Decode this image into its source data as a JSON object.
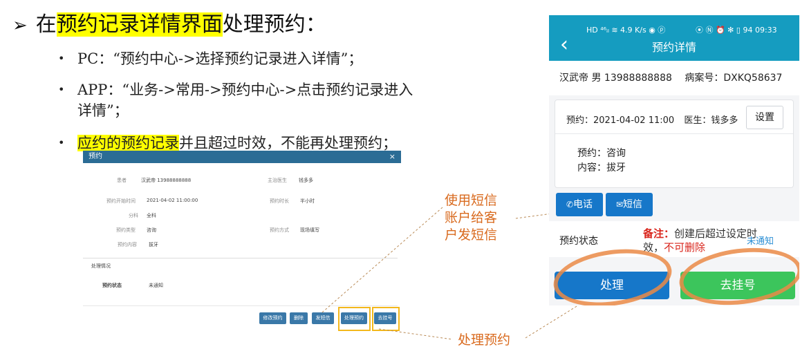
{
  "slide": {
    "main_arrow": "➢",
    "main_prefix": "在",
    "main_highlight": "预约记录详情界面",
    "main_suffix": "处理预约：",
    "bullets": [
      {
        "text": "PC：“预约中心->选择预约记录进入详情”；"
      },
      {
        "line1": "APP：“业务->常用->预约中心->点击预约记录进入",
        "line2": "详情”；"
      },
      {
        "highlight": "应约的预约记录",
        "rest": "并且超过时效，不能再处理预约；"
      }
    ],
    "callout_sms": [
      "使用短信",
      "账户给客",
      "户发短信"
    ],
    "callout_process": "处理预约"
  },
  "pc": {
    "title": "预约",
    "close": "×",
    "fields": {
      "patient_label": "患者",
      "patient_value": "汉武帝 13988888888",
      "doctor_label": "主治医生",
      "doctor_value": "钱多多",
      "start_label": "预约开始时间",
      "start_value": "2021-04-02 11:00:00",
      "duration_label": "预约时长",
      "duration_value": "半小时",
      "dept_label": "分科",
      "dept_value": "全科",
      "type_label": "预约类型",
      "type_value": "咨询",
      "method_label": "预约方式",
      "method_value": "现场填写",
      "content_label": "预约内容",
      "content_value": "拔牙"
    },
    "section_title": "处理情况",
    "status_label": "预约状态",
    "status_value": "未通知",
    "buttons": [
      "修改预约",
      "删除",
      "发短信",
      "处理预约",
      "去挂号"
    ]
  },
  "app": {
    "status_left": "HD ⁴⁶ᵢₗ ≋ 4.9 K/s ◉ ⓟ",
    "status_right": "⦿ Ⓝ ⏰ ✻ ▯ 94 09:33",
    "back_icon": "‹",
    "title": "预约详情",
    "patient_name": "汉武帝",
    "patient_gender": "男",
    "patient_phone": "13988888888",
    "record_label": "病案号：",
    "record_value": "DXKQ58637",
    "appt_time_label": "预约：",
    "appt_time_value": "2021-04-02 11:00",
    "doctor_label": "医生：",
    "doctor_value": "钱多多",
    "settings_button": "设置",
    "appt_type_label": "预约：",
    "appt_type_value": "咨询",
    "content_label": "内容：",
    "content_value": "拔牙",
    "call_button": "电话",
    "sms_button": "短信",
    "status_label": "预约状态",
    "status_value": "未通知",
    "note_label": "备注：",
    "note_text1": "创建后超过设定时",
    "note_text2": "效，",
    "note_text3": "不可删除",
    "process_button": "处理",
    "register_button": "去挂号",
    "colors": {
      "header": "#159cc0",
      "primary": "#1677c9",
      "success": "#3cc55c",
      "note_red": "#d9251c",
      "callout_orange": "#d96a1e"
    }
  }
}
